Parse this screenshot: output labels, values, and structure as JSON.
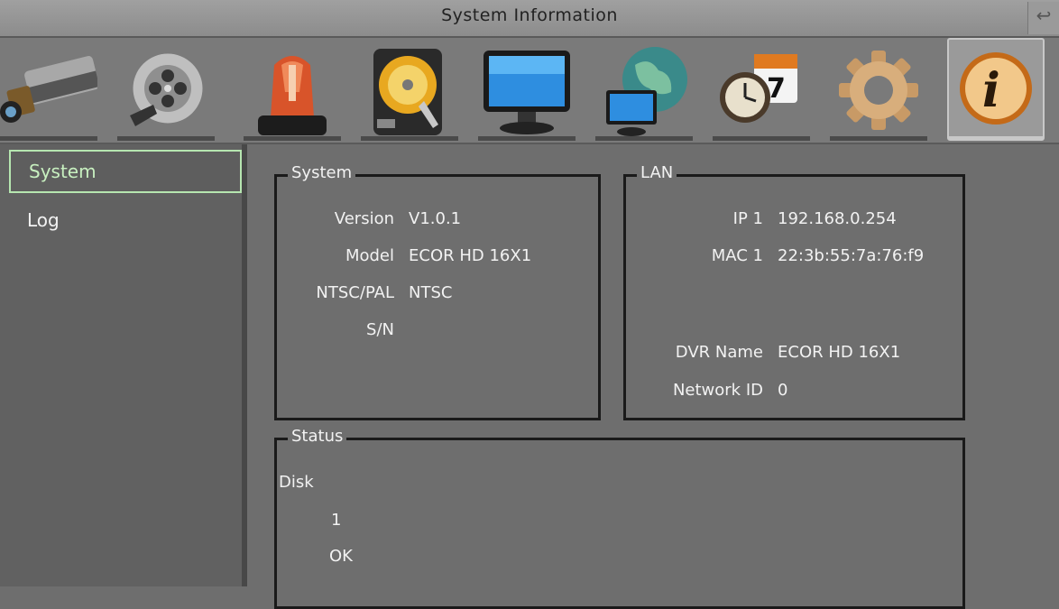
{
  "window": {
    "title": "System Information",
    "corner_icon": "corner-arrow-icon"
  },
  "toolbar": {
    "icons": [
      {
        "name": "camera-icon"
      },
      {
        "name": "record-reel-icon"
      },
      {
        "name": "alarm-icon"
      },
      {
        "name": "disk-icon"
      },
      {
        "name": "display-icon"
      },
      {
        "name": "network-icon"
      },
      {
        "name": "schedule-icon"
      },
      {
        "name": "settings-gear-icon"
      },
      {
        "name": "info-icon",
        "active": true
      }
    ]
  },
  "sidebar": {
    "items": [
      {
        "label": "System",
        "selected": true
      },
      {
        "label": "Log",
        "selected": false
      }
    ]
  },
  "system": {
    "legend": "System",
    "version_label": "Version",
    "version": "V1.0.1",
    "model_label": "Model",
    "model": "ECOR HD 16X1",
    "ntsc_label": "NTSC/PAL",
    "ntsc": "NTSC",
    "sn_label": "S/N",
    "sn": ""
  },
  "lan": {
    "legend": "LAN",
    "ip_label": "IP 1",
    "ip": "192.168.0.254",
    "mac_label": "MAC 1",
    "mac": "22:3b:55:7a:76:f9",
    "dvr_label": "DVR Name",
    "dvr": "ECOR HD 16X1",
    "netid_label": "Network ID",
    "netid": "0"
  },
  "status": {
    "legend": "Status",
    "disk_label": "Disk",
    "disk_number": "1",
    "disk_state": "OK"
  },
  "colors": {
    "selected_border": "#b6e6b0",
    "background": "#6e6e6e"
  }
}
